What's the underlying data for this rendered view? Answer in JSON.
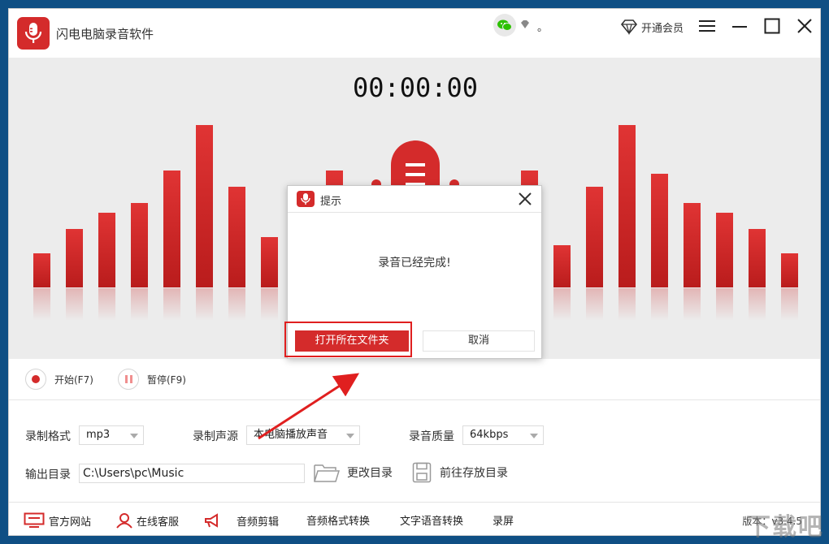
{
  "window": {
    "title": "闪电电脑录音软件",
    "dot_text": "。",
    "vip_label": "开通会员"
  },
  "recorder": {
    "timer": "00:00:00",
    "level_bars": [
      0.21,
      0.36,
      0.46,
      0.52,
      0.72,
      1.0,
      0.62,
      0.31,
      0.72,
      0.72,
      0.26,
      0.62,
      1.0,
      0.7,
      0.52,
      0.46,
      0.36,
      0.21
    ]
  },
  "controls": {
    "start": "开始(F7)",
    "pause": "暂停(F9)"
  },
  "settings": {
    "format_label": "录制格式",
    "format_value": "mp3",
    "source_label": "录制声源",
    "source_value": "本电脑播放声音",
    "quality_label": "录音质量",
    "quality_value": "64kbps",
    "output_label": "输出目录",
    "output_path": "C:\\Users\\pc\\Music",
    "change_dir": "更改目录",
    "open_dir": "前往存放目录"
  },
  "footer": {
    "website": "官方网站",
    "support": "在线客服",
    "audio_edit": "音频剪辑",
    "format_convert": "音频格式转换",
    "tts": "文字语音转换",
    "screen_record": "录屏",
    "version": "版本：v3.4.5"
  },
  "dialog": {
    "title": "提示",
    "message": "录音已经完成!",
    "open_folder": "打开所在文件夹",
    "cancel": "取消"
  },
  "watermark": "下载吧",
  "colors": {
    "brand_red": "#d42b2b",
    "stage_bg": "#ececec",
    "desktop": "#0f4f84"
  }
}
